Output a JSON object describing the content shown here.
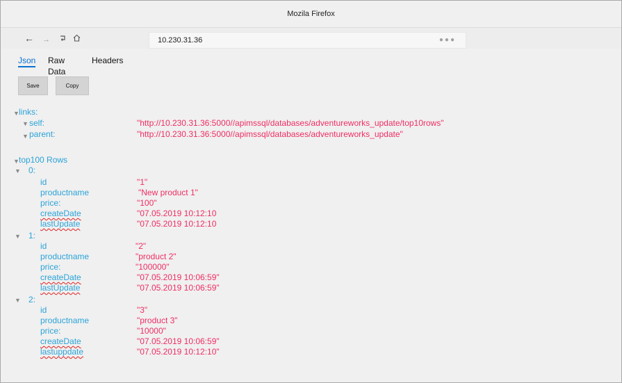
{
  "window": {
    "title": "Mozila Firefox"
  },
  "navbar": {
    "back_icon": "arrow-left-icon",
    "forward_icon": "arrow-right-icon",
    "reload_icon": "reload-icon",
    "home_icon": "home-icon",
    "url": "10.230.31.36",
    "menu_icon": "more-dots-icon"
  },
  "tabs": {
    "json": "Json",
    "raw": "Raw Data",
    "headers": "Headers"
  },
  "buttons": {
    "save": "Save",
    "copy": "Copy"
  },
  "json": {
    "links_key": "links:",
    "self_key": "self:",
    "self_val": "\"http://10.230.31.36:5000//apimssql/databases/adventureworks_update/top10rows\"",
    "parent_key": "parent:",
    "parent_val": "\"http://10.230.31.36:5000//apimssql/databases/adventureworks_update\"",
    "rows_key": "top100 Rows",
    "rows": [
      {
        "index": "0:",
        "fields": [
          {
            "key": "id",
            "val": "\"1\""
          },
          {
            "key": "productname",
            "val": "\"New product 1\""
          },
          {
            "key": "price:",
            "val": "\"100\""
          },
          {
            "key": "createDate",
            "val": "\"07.05.2019 10:12:10"
          },
          {
            "key": "lastUpdate",
            "val": "\"07.05.2019 10:12:10"
          }
        ]
      },
      {
        "index": "1:",
        "fields": [
          {
            "key": "id",
            "val": "\"2\""
          },
          {
            "key": "productname",
            "val": "\"product 2\""
          },
          {
            "key": "price:",
            "val": "\"100000\""
          },
          {
            "key": "createDate",
            "val": "\"07.05.2019 10:06:59\""
          },
          {
            "key": "lastUpdate",
            "val": "\"07.05.2019 10:06:59\""
          }
        ]
      },
      {
        "index": "2:",
        "fields": [
          {
            "key": "id",
            "val": "\"3\""
          },
          {
            "key": "productname",
            "val": "\"product 3\""
          },
          {
            "key": "price:",
            "val": "\"10000\""
          },
          {
            "key": "createDate",
            "val": "\"07.05.2019 10:06:59\""
          },
          {
            "key": "lastuppdate",
            "val": "\"07.05.2019 10:12:10\""
          }
        ]
      }
    ]
  },
  "colors": {
    "key": "#29a3d8",
    "value": "#ef2d63",
    "tab_active": "#0a72d3"
  }
}
